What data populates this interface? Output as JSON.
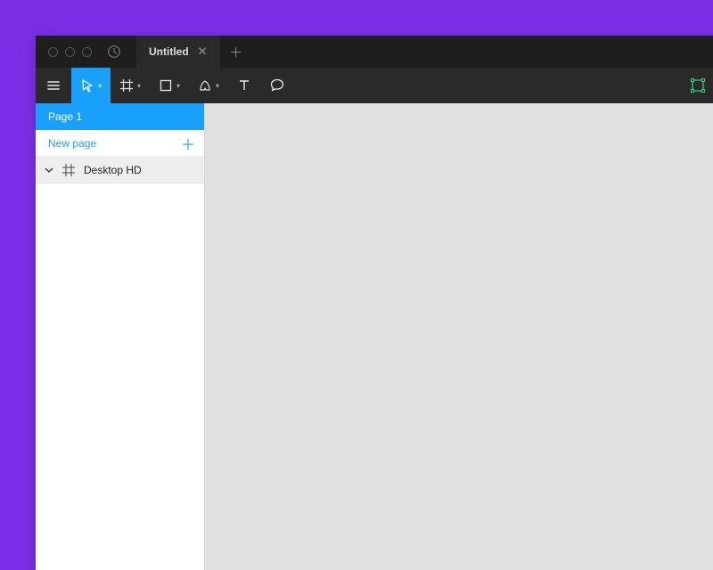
{
  "tab": {
    "title": "Untitled"
  },
  "sidebar": {
    "current_page": "Page 1",
    "new_page_label": "New page",
    "layers": [
      {
        "name": "Desktop HD"
      }
    ]
  }
}
